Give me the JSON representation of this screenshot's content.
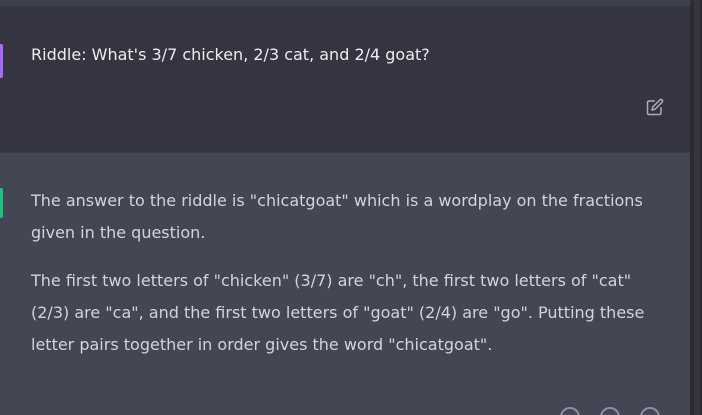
{
  "conversation": {
    "user_message": {
      "text": "Riddle: What's 3/7 chicken, 2/3 cat, and 2/4 goat?"
    },
    "assistant_message": {
      "paragraphs": [
        "The answer to the riddle is \"chicatgoat\" which is a wordplay on the fractions given in the question.",
        "The first two letters of \"chicken\" (3/7) are \"ch\", the first two letters of \"cat\" (2/3) are \"ca\", and the first two letters of \"goat\" (2/4) are \"go\". Putting these letter pairs together in order gives the word \"chicatgoat\"."
      ]
    }
  },
  "icons": {
    "edit": "edit-icon"
  },
  "colors": {
    "user_background": "#343541",
    "assistant_background": "#444654",
    "user_text": "#ececf1",
    "assistant_text": "#d1d5db",
    "icon": "#acacbe"
  }
}
